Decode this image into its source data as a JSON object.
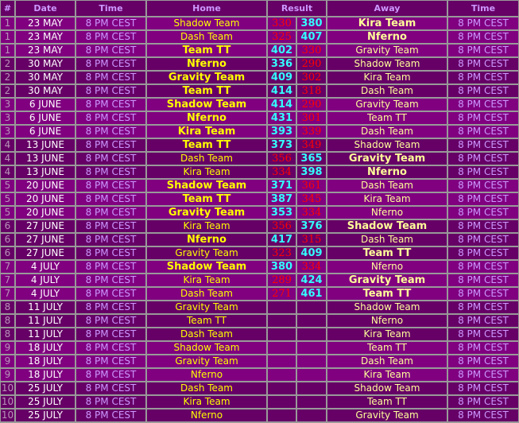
{
  "headers": {
    "round": "#",
    "date": "Date",
    "time_left": "Time",
    "home": "Home",
    "result": "Result",
    "away": "Away",
    "time_right": "Time"
  },
  "colors": {
    "odd_round_bg": "#800080",
    "even_round_bg": "#660066",
    "border": "#999999",
    "winner_score": "#33ffff",
    "loser_score": "#ff0000",
    "home_team": "#ffff00",
    "away_team": "#ffff99",
    "time": "#cc99ff"
  },
  "matches": [
    {
      "round": "1",
      "date": "23 MAY",
      "time": "8 PM CEST",
      "home": "Shadow Team",
      "home_score": "330",
      "away_score": "380",
      "away": "Kira Team",
      "time2": "8 PM CEST",
      "winner": "away"
    },
    {
      "round": "1",
      "date": "23 MAY",
      "time": "8 PM CEST",
      "home": "Dash Team",
      "home_score": "325",
      "away_score": "407",
      "away": "Nferno",
      "time2": "8 PM CEST",
      "winner": "away"
    },
    {
      "round": "1",
      "date": "23 MAY",
      "time": "8 PM CEST",
      "home": "Team TT",
      "home_score": "402",
      "away_score": "330",
      "away": "Gravity Team",
      "time2": "8 PM CEST",
      "winner": "home"
    },
    {
      "round": "2",
      "date": "30 MAY",
      "time": "8 PM CEST",
      "home": "Nferno",
      "home_score": "336",
      "away_score": "290",
      "away": "Shadow Team",
      "time2": "8 PM CEST",
      "winner": "home"
    },
    {
      "round": "2",
      "date": "30 MAY",
      "time": "8 PM CEST",
      "home": "Gravity Team",
      "home_score": "409",
      "away_score": "302",
      "away": "Kira Team",
      "time2": "8 PM CEST",
      "winner": "home"
    },
    {
      "round": "2",
      "date": "30 MAY",
      "time": "8 PM CEST",
      "home": "Team TT",
      "home_score": "414",
      "away_score": "318",
      "away": "Dash Team",
      "time2": "8 PM CEST",
      "winner": "home"
    },
    {
      "round": "3",
      "date": "6 JUNE",
      "time": "8 PM CEST",
      "home": "Shadow Team",
      "home_score": "414",
      "away_score": "290",
      "away": "Gravity Team",
      "time2": "8 PM CEST",
      "winner": "home"
    },
    {
      "round": "3",
      "date": "6 JUNE",
      "time": "8 PM CEST",
      "home": "Nferno",
      "home_score": "431",
      "away_score": "301",
      "away": "Team TT",
      "time2": "8 PM CEST",
      "winner": "home"
    },
    {
      "round": "3",
      "date": "6 JUNE",
      "time": "8 PM CEST",
      "home": "Kira Team",
      "home_score": "393",
      "away_score": "339",
      "away": "Dash Team",
      "time2": "8 PM CEST",
      "winner": "home"
    },
    {
      "round": "4",
      "date": "13 JUNE",
      "time": "8 PM CEST",
      "home": "Team TT",
      "home_score": "373",
      "away_score": "349",
      "away": "Shadow Team",
      "time2": "8 PM CEST",
      "winner": "home"
    },
    {
      "round": "4",
      "date": "13 JUNE",
      "time": "8 PM CEST",
      "home": "Dash Team",
      "home_score": "356",
      "away_score": "365",
      "away": "Gravity Team",
      "time2": "8 PM CEST",
      "winner": "away"
    },
    {
      "round": "4",
      "date": "13 JUNE",
      "time": "8 PM CEST",
      "home": "Kira Team",
      "home_score": "334",
      "away_score": "398",
      "away": "Nferno",
      "time2": "8 PM CEST",
      "winner": "away"
    },
    {
      "round": "5",
      "date": "20 JUNE",
      "time": "8 PM CEST",
      "home": "Shadow Team",
      "home_score": "371",
      "away_score": "361",
      "away": "Dash Team",
      "time2": "8 PM CEST",
      "winner": "home"
    },
    {
      "round": "5",
      "date": "20 JUNE",
      "time": "8 PM CEST",
      "home": "Team TT",
      "home_score": "387",
      "away_score": "345",
      "away": "Kira Team",
      "time2": "8 PM CEST",
      "winner": "home"
    },
    {
      "round": "5",
      "date": "20 JUNE",
      "time": "8 PM CEST",
      "home": "Gravity Team",
      "home_score": "353",
      "away_score": "334",
      "away": "Nferno",
      "time2": "8 PM CEST",
      "winner": "home"
    },
    {
      "round": "6",
      "date": "27 JUNE",
      "time": "8 PM CEST",
      "home": "Kira Team",
      "home_score": "356",
      "away_score": "376",
      "away": "Shadow Team",
      "time2": "8 PM CEST",
      "winner": "away"
    },
    {
      "round": "6",
      "date": "27 JUNE",
      "time": "8 PM CEST",
      "home": "Nferno",
      "home_score": "417",
      "away_score": "315",
      "away": "Dash Team",
      "time2": "8 PM CEST",
      "winner": "home"
    },
    {
      "round": "6",
      "date": "27 JUNE",
      "time": "8 PM CEST",
      "home": "Gravity Team",
      "home_score": "323",
      "away_score": "409",
      "away": "Team TT",
      "time2": "8 PM CEST",
      "winner": "away"
    },
    {
      "round": "7",
      "date": "4 JULY",
      "time": "8 PM CEST",
      "home": "Shadow Team",
      "home_score": "380",
      "away_score": "334",
      "away": "Nferno",
      "time2": "8 PM CEST",
      "winner": "home"
    },
    {
      "round": "7",
      "date": "4 JULY",
      "time": "8 PM CEST",
      "home": "Kira Team",
      "home_score": "289",
      "away_score": "424",
      "away": "Gravity Team",
      "time2": "8 PM CEST",
      "winner": "away"
    },
    {
      "round": "7",
      "date": "4 JULY",
      "time": "8 PM CEST",
      "home": "Dash Team",
      "home_score": "271",
      "away_score": "461",
      "away": "Team TT",
      "time2": "8 PM CEST",
      "winner": "away"
    },
    {
      "round": "8",
      "date": "11 JULY",
      "time": "8 PM CEST",
      "home": "Gravity Team",
      "home_score": "",
      "away_score": "",
      "away": "Shadow Team",
      "time2": "8 PM CEST",
      "winner": ""
    },
    {
      "round": "8",
      "date": "11 JULY",
      "time": "8 PM CEST",
      "home": "Team TT",
      "home_score": "",
      "away_score": "",
      "away": "Nferno",
      "time2": "8 PM CEST",
      "winner": ""
    },
    {
      "round": "8",
      "date": "11 JULY",
      "time": "8 PM CEST",
      "home": "Dash Team",
      "home_score": "",
      "away_score": "",
      "away": "Kira Team",
      "time2": "8 PM CEST",
      "winner": ""
    },
    {
      "round": "9",
      "date": "18 JULY",
      "time": "8 PM CEST",
      "home": "Shadow Team",
      "home_score": "",
      "away_score": "",
      "away": "Team TT",
      "time2": "8 PM CEST",
      "winner": ""
    },
    {
      "round": "9",
      "date": "18 JULY",
      "time": "8 PM CEST",
      "home": "Gravity Team",
      "home_score": "",
      "away_score": "",
      "away": "Dash Team",
      "time2": "8 PM CEST",
      "winner": ""
    },
    {
      "round": "9",
      "date": "18 JULY",
      "time": "8 PM CEST",
      "home": "Nferno",
      "home_score": "",
      "away_score": "",
      "away": "Kira Team",
      "time2": "8 PM CEST",
      "winner": ""
    },
    {
      "round": "10",
      "date": "25 JULY",
      "time": "8 PM CEST",
      "home": "Dash Team",
      "home_score": "",
      "away_score": "",
      "away": "Shadow Team",
      "time2": "8 PM CEST",
      "winner": ""
    },
    {
      "round": "10",
      "date": "25 JULY",
      "time": "8 PM CEST",
      "home": "Kira Team",
      "home_score": "",
      "away_score": "",
      "away": "Team TT",
      "time2": "8 PM CEST",
      "winner": ""
    },
    {
      "round": "10",
      "date": "25 JULY",
      "time": "8 PM CEST",
      "home": "Nferno",
      "home_score": "",
      "away_score": "",
      "away": "Gravity Team",
      "time2": "8 PM CEST",
      "winner": ""
    }
  ]
}
